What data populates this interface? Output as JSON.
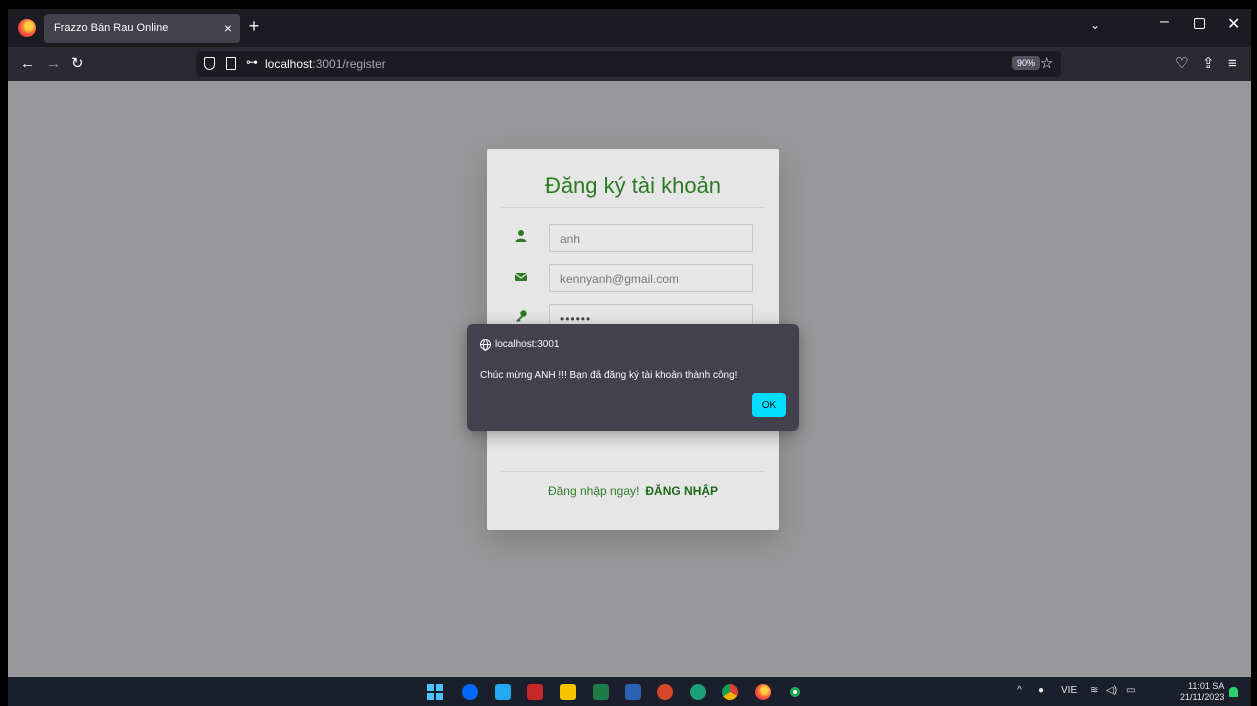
{
  "browser": {
    "tab_title": "Frazzo Bán Rau Online",
    "tab_close": "×",
    "new_tab": "+",
    "url_host": "localhost",
    "url_path": ":3001/register",
    "zoom": "90%"
  },
  "page": {
    "title": "Đăng ký tài khoản",
    "fields": {
      "name": "anh",
      "email": "kennyanh@gmail.com",
      "password": "••••••"
    },
    "login_prompt": "Đăng nhập ngay!",
    "login_link": "ĐĂNG NHẬP",
    "brand_color": "#2c7a23"
  },
  "dialog": {
    "origin": "localhost:3001",
    "message": "Chúc mừng ANH !!! Bạn đã đăng ký tài khoản thành công!",
    "ok_label": "OK",
    "ok_color": "#00ddff"
  },
  "taskbar": {
    "language": "VIE",
    "time": "11:01 SA",
    "date": "21/11/2023",
    "apps": [
      "start-icon",
      "zalo-icon",
      "vscode-icon",
      "app-icon",
      "sticky-notes-icon",
      "excel-icon",
      "word-icon",
      "powerpoint-icon",
      "edge-icon",
      "chrome-icon",
      "firefox-icon",
      "mongodb-icon"
    ]
  }
}
